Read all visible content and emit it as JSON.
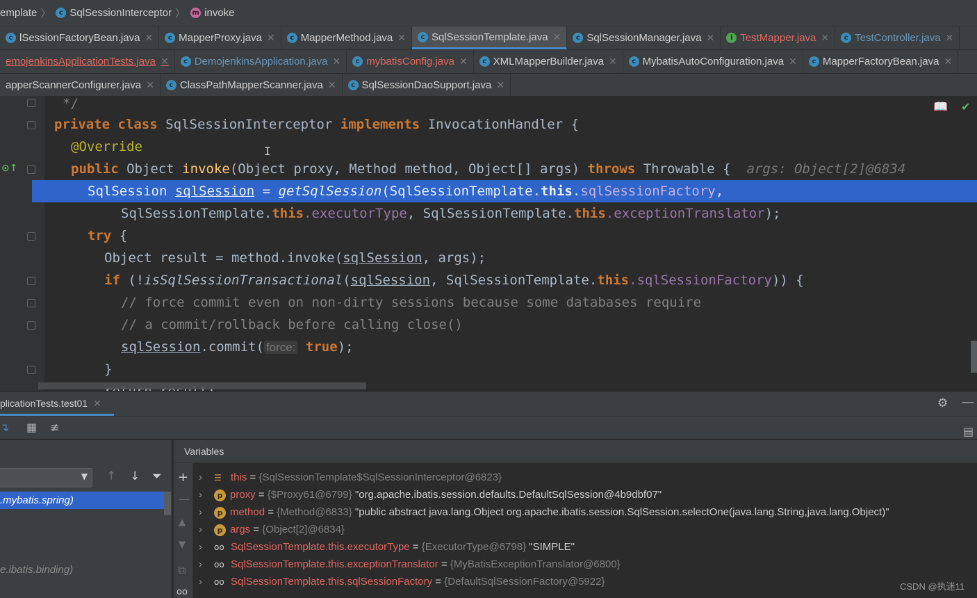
{
  "breadcrumb": [
    "emplate",
    "SqlSessionInterceptor",
    "invoke"
  ],
  "tabs_row1": [
    {
      "label": "lSessionFactoryBean.java",
      "icon": "class-icon",
      "style": ""
    },
    {
      "label": "MapperProxy.java",
      "icon": "class-icon",
      "style": ""
    },
    {
      "label": "MapperMethod.java",
      "icon": "class-icon",
      "style": ""
    },
    {
      "label": "SqlSessionTemplate.java",
      "icon": "class-icon",
      "style": "active"
    },
    {
      "label": "SqlSessionManager.java",
      "icon": "class-icon",
      "style": ""
    },
    {
      "label": "TestMapper.java",
      "icon": "mapper-icon",
      "style": "red"
    },
    {
      "label": "TestController.java",
      "icon": "class-icon",
      "style": "blue"
    }
  ],
  "tabs_row2": [
    {
      "label": "emojenkinsApplicationTests.java",
      "icon": "",
      "style": "red u"
    },
    {
      "label": "DemojenkinsApplication.java",
      "icon": "class-icon",
      "style": "blue"
    },
    {
      "label": "mybatisConfig.java",
      "icon": "class-icon",
      "style": "orange"
    },
    {
      "label": "XMLMapperBuilder.java",
      "icon": "class-icon",
      "style": ""
    },
    {
      "label": "MybatisAutoConfiguration.java",
      "icon": "class-icon",
      "style": ""
    },
    {
      "label": "MapperFactoryBean.java",
      "icon": "class-icon",
      "style": ""
    }
  ],
  "tabs_row3": [
    {
      "label": "apperScannerConfigurer.java",
      "icon": "",
      "style": ""
    },
    {
      "label": "ClassPathMapperScanner.java",
      "icon": "class-icon",
      "style": ""
    },
    {
      "label": "SqlSessionDaoSupport.java",
      "icon": "class-icon",
      "style": ""
    }
  ],
  "code": {
    "l0": "*/",
    "l1_kw1": "private",
    "l1_kw2": "class",
    "l1_name": "SqlSessionInterceptor",
    "l1_kw3": "implements",
    "l1_iface": "InvocationHandler",
    "l1_brace": "{",
    "l2": "@Override",
    "l3_kw": "public",
    "l3_ret": "Object",
    "l3_fn": "invoke",
    "l3_sig1": "(Object proxy, Method method, Object[] args)",
    "l3_throws": "throws",
    "l3_exc": "Throwable {",
    "l3_hint": "args: Object[2]@6834",
    "l4_a": "SqlSession ",
    "l4_var": "sqlSession",
    "l4_b": " = ",
    "l4_fn": "getSqlSession",
    "l4_c": "(SqlSessionTemplate.",
    "l4_this": "this",
    "l4_d": ".",
    "l4_fld": "sqlSessionFactory",
    "l4_e": ",",
    "l5_a": "SqlSessionTemplate.",
    "l5_this1": "this",
    "l5_fld1": ".executorType",
    "l5_b": ", SqlSessionTemplate.",
    "l5_this2": "this",
    "l5_fld2": ".exceptionTranslator",
    "l5_c": ");",
    "l6_kw": "try",
    "l6_b": " {",
    "l7_a": "Object result = method.",
    "l7_fn": "invoke",
    "l7_b": "(",
    "l7_var": "sqlSession",
    "l7_c": ", args);",
    "l8_kw": "if",
    "l8_a": " (!",
    "l8_fn": "isSqlSessionTransactional",
    "l8_b": "(",
    "l8_var": "sqlSession",
    "l8_c": ", SqlSessionTemplate.",
    "l8_this": "this",
    "l8_fld": ".sqlSessionFactory",
    "l8_d": ")) {",
    "l9": "// force commit even on non-dirty sessions because some databases require",
    "l10": "// a commit/rollback before calling close()",
    "l11_var": "sqlSession",
    "l11_a": ".",
    "l11_fn": "commit",
    "l11_b": "(",
    "l11_param": "force:",
    "l11_kw": "true",
    "l11_c": ");",
    "l12": "}",
    "l13": "return result;"
  },
  "debug": {
    "session_tab": "plicationTests.test01",
    "variables_title": "Variables",
    "frame_selected": ".mybatis.spring)",
    "frame_other": "e.ibatis.binding)"
  },
  "variables": [
    {
      "icon": "field-list-icon",
      "name": "this",
      "eq": " = ",
      "type": "{SqlSessionTemplate$SqlSessionInterceptor@6823}",
      "value": ""
    },
    {
      "icon": "param-icon",
      "name": "proxy",
      "eq": " = ",
      "type": "{$Proxy61@6799}",
      "value": " \"org.apache.ibatis.session.defaults.DefaultSqlSession@4b9dbf07\""
    },
    {
      "icon": "param-icon",
      "name": "method",
      "eq": " = ",
      "type": "{Method@6833}",
      "value": " \"public abstract java.lang.Object org.apache.ibatis.session.SqlSession.selectOne(java.lang.String,java.lang.Object)\""
    },
    {
      "icon": "param-icon",
      "name": "args",
      "eq": " = ",
      "type": "{Object[2]@6834}",
      "value": ""
    },
    {
      "icon": "watch-icon",
      "name": "SqlSessionTemplate.this.executorType",
      "eq": " = ",
      "type": "{ExecutorType@6798}",
      "value": " \"SIMPLE\""
    },
    {
      "icon": "watch-icon",
      "name": "SqlSessionTemplate.this.exceptionTranslator",
      "eq": " = ",
      "type": "{MyBatisExceptionTranslator@6800}",
      "value": ""
    },
    {
      "icon": "watch-icon",
      "name": "SqlSessionTemplate.this.sqlSessionFactory",
      "eq": " = ",
      "type": "{DefaultSqlSessionFactory@5922}",
      "value": ""
    }
  ],
  "watermark": "CSDN @执迷11"
}
